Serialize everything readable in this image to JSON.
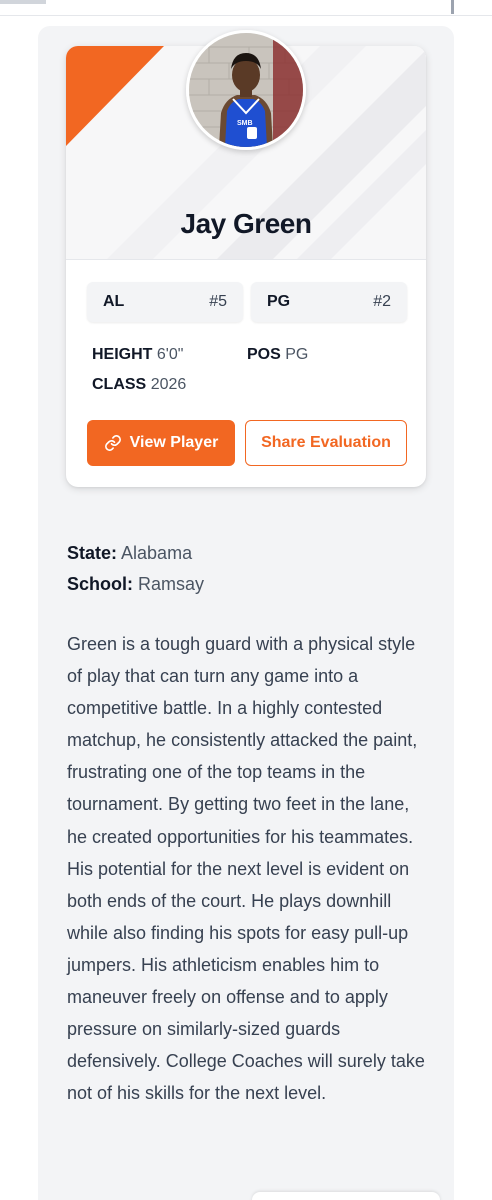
{
  "player": {
    "name": "Jay Green",
    "state_abbr": "AL",
    "state_rank": "#5",
    "position_abbr": "PG",
    "position_rank": "#2",
    "height_label": "HEIGHT",
    "height_value": "6'0\"",
    "pos_label": "POS",
    "pos_value": "PG",
    "class_label": "CLASS",
    "class_value": "2026",
    "jersey_text": "SMB"
  },
  "actions": {
    "view_player": "View Player",
    "share_evaluation": "Share Evaluation"
  },
  "details": {
    "state_label": "State:",
    "state_value": "Alabama",
    "school_label": "School:",
    "school_value": "Ramsay"
  },
  "evaluation": "Green is a tough guard with a physical style of play that can turn any game into a competitive battle. In a highly contested matchup, he consistently attacked the paint, frustrating one of the top teams in the tournament. By getting two feet in the lane, he created opportunities for his teammates. His potential for the next level is evident on both ends of the court. He plays downhill while also finding his spots for easy pull-up jumpers. His athleticism enables him to maneuver freely on offense and to apply pressure on similarly-sized guards defensively. College Coaches will surely take not of his skills for the next level.",
  "colors": {
    "accent": "#f26722",
    "panel_bg": "#f3f4f6",
    "jersey": "#1f4fd1"
  },
  "icons": {
    "view_player": "link-icon"
  }
}
